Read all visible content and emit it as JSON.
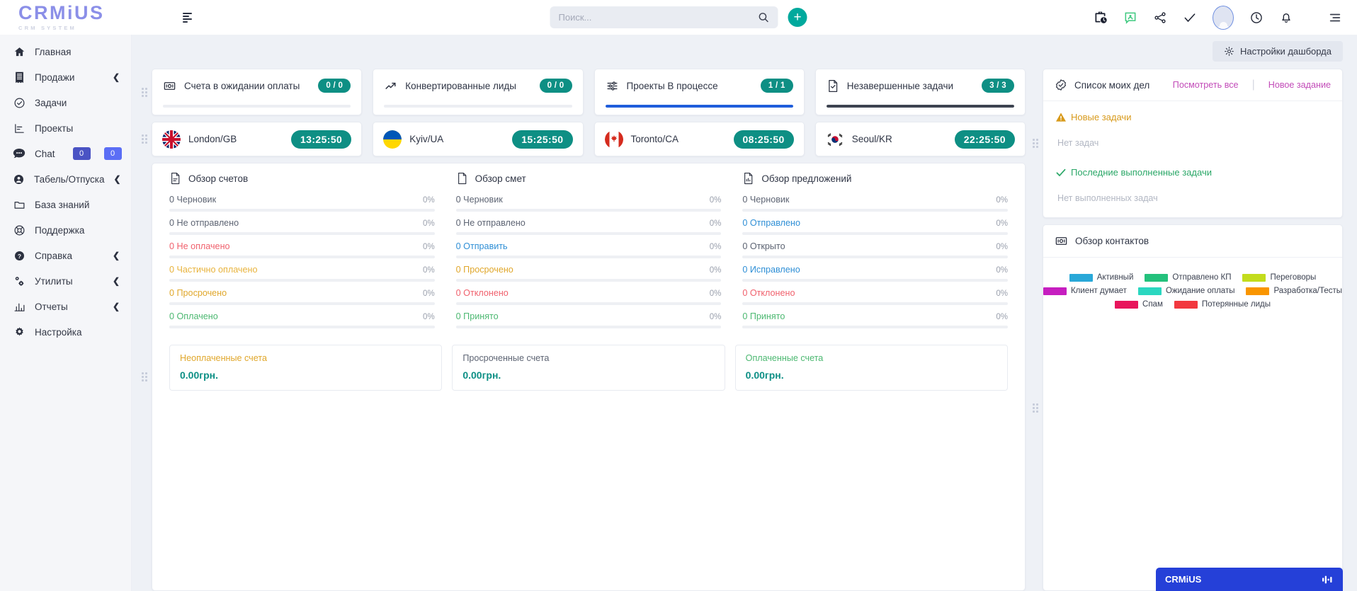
{
  "brand": {
    "name": "CRMiUS",
    "tagline": "CRM SYSTEM"
  },
  "header": {
    "menu_icon": "menu-icon",
    "search": {
      "placeholder": "Поиск...",
      "value": "",
      "icon": "search-icon"
    },
    "add_button": "+",
    "icons": [
      "briefcase-clock-icon",
      "contact-card-icon",
      "share-icon",
      "check-icon",
      "avatar-icon",
      "clock-icon",
      "bell-icon",
      "list-menu-icon"
    ]
  },
  "sidebar": {
    "items": [
      {
        "label": "Главная",
        "icon": "home-icon",
        "chevron": false
      },
      {
        "label": "Продажи",
        "icon": "receipt-icon",
        "chevron": true
      },
      {
        "label": "Задачи",
        "icon": "check-circle-icon",
        "chevron": false
      },
      {
        "label": "Проекты",
        "icon": "chart-icon",
        "chevron": false
      },
      {
        "label": "Chat",
        "icon": "chat-icon",
        "chevron": false,
        "badges": [
          "0",
          "0"
        ]
      },
      {
        "label": "Табель/Отпуска",
        "icon": "user-icon",
        "chevron": true
      },
      {
        "label": "База знаний",
        "icon": "folder-icon",
        "chevron": false
      },
      {
        "label": "Поддержка",
        "icon": "lifebuoy-icon",
        "chevron": false
      },
      {
        "label": "Справка",
        "icon": "question-icon",
        "chevron": true
      },
      {
        "label": "Утилиты",
        "icon": "gears-icon",
        "chevron": true
      },
      {
        "label": "Отчеты",
        "icon": "report-icon",
        "chevron": true
      },
      {
        "label": "Настройка",
        "icon": "gear-icon",
        "chevron": false
      }
    ]
  },
  "dashboard": {
    "settings_button": "Настройки дашборда",
    "settings_icon": "gear-icon",
    "stats": [
      {
        "title": "Счета в ожидании оплаты",
        "value": "0 / 0",
        "icon": "invoice-icon",
        "progress": 0,
        "bar_color": "#eceef3"
      },
      {
        "title": "Конвертированные лиды",
        "value": "0 / 0",
        "icon": "trend-up-icon",
        "progress": 0,
        "bar_color": "#eceef3"
      },
      {
        "title": "Проекты В процессе",
        "value": "1 / 1",
        "icon": "sliders-icon",
        "progress": 100,
        "bar_color": "#1f5ddb"
      },
      {
        "title": "Незавершенные задачи",
        "value": "3 / 3",
        "icon": "task-doc-icon",
        "progress": 100,
        "bar_color": "#3d4350"
      }
    ],
    "clocks": [
      {
        "city": "London/GB",
        "time": "13:25:50",
        "flag": "flag-gb"
      },
      {
        "city": "Kyiv/UA",
        "time": "15:25:50",
        "flag": "flag-ua"
      },
      {
        "city": "Toronto/CA",
        "time": "08:25:50",
        "flag": "flag-ca"
      },
      {
        "city": "Seoul/KR",
        "time": "22:25:50",
        "flag": "flag-kr"
      }
    ],
    "overviews": [
      {
        "title": "Обзор счетов",
        "icon": "doc-lines-icon",
        "items": [
          {
            "label": "0 Черновик",
            "pct": "0%",
            "color": "#5d6473"
          },
          {
            "label": "0 Не отправлено",
            "pct": "0%",
            "color": "#5d6473"
          },
          {
            "label": "0 Не оплачено",
            "pct": "0%",
            "color": "#f0616d"
          },
          {
            "label": "0 Частично оплачено",
            "pct": "0%",
            "color": "#e8b33c"
          },
          {
            "label": "0 Просрочено",
            "pct": "0%",
            "color": "#e0a72b"
          },
          {
            "label": "0 Оплачено",
            "pct": "0%",
            "color": "#4cb871"
          }
        ]
      },
      {
        "title": "Обзор смет",
        "icon": "doc-blank-icon",
        "items": [
          {
            "label": "0 Черновик",
            "pct": "0%",
            "color": "#5d6473"
          },
          {
            "label": "0 Не отправлено",
            "pct": "0%",
            "color": "#5d6473"
          },
          {
            "label": "0 Отправить",
            "pct": "0%",
            "color": "#2f8fd6"
          },
          {
            "label": "0 Просрочено",
            "pct": "0%",
            "color": "#e0a72b"
          },
          {
            "label": "0 Отклонено",
            "pct": "0%",
            "color": "#f0616d"
          },
          {
            "label": "0 Принято",
            "pct": "0%",
            "color": "#4cb871"
          }
        ]
      },
      {
        "title": "Обзор предложений",
        "icon": "doc-chart-icon",
        "items": [
          {
            "label": "0 Черновик",
            "pct": "0%",
            "color": "#5d6473"
          },
          {
            "label": "0 Отправлено",
            "pct": "0%",
            "color": "#2f8fd6"
          },
          {
            "label": "0 Открыто",
            "pct": "0%",
            "color": "#5d6473"
          },
          {
            "label": "0 Исправлено",
            "pct": "0%",
            "color": "#2f8fd6"
          },
          {
            "label": "0 Отклонено",
            "pct": "0%",
            "color": "#f0616d"
          },
          {
            "label": "0 Принято",
            "pct": "0%",
            "color": "#4cb871"
          }
        ]
      }
    ],
    "summaries": [
      {
        "title": "Неоплаченные счета",
        "amount": "0.00грн.",
        "color": "#e0a72b"
      },
      {
        "title": "Просроченные счета",
        "amount": "0.00грн.",
        "color": "#5d6473"
      },
      {
        "title": "Оплаченные счета",
        "amount": "0.00грн.",
        "color": "#4cb871"
      }
    ],
    "todo": {
      "title": "Список моих дел",
      "icon": "check-badge-icon",
      "view_all": "Посмотреть все",
      "new_task": "Новое задание",
      "new_section": "Новые задачи",
      "new_section_icon": "warning-icon",
      "new_empty": "Нет задач",
      "done_section": "Последние выполненные задачи",
      "done_section_icon": "check-icon",
      "done_empty": "Нет выполненных задач"
    },
    "contacts": {
      "title": "Обзор контактов",
      "icon": "contact-card-icon",
      "legend": [
        {
          "label": "Активный",
          "color": "#29a8d8"
        },
        {
          "label": "Отправлено КП",
          "color": "#24c17c"
        },
        {
          "label": "Переговоры",
          "color": "#c3dc1c"
        },
        {
          "label": "Клиент думает",
          "color": "#c61ec0"
        },
        {
          "label": "Ожидание оплаты",
          "color": "#2bd7c0"
        },
        {
          "label": "Разработка/Тесты",
          "color": "#f99500"
        },
        {
          "label": "Спам",
          "color": "#e8155c"
        },
        {
          "label": "Потерянные лиды",
          "color": "#f2383f"
        }
      ]
    },
    "chatbar": {
      "title": "CRMiUS",
      "icon": "chat-bars-icon"
    }
  }
}
